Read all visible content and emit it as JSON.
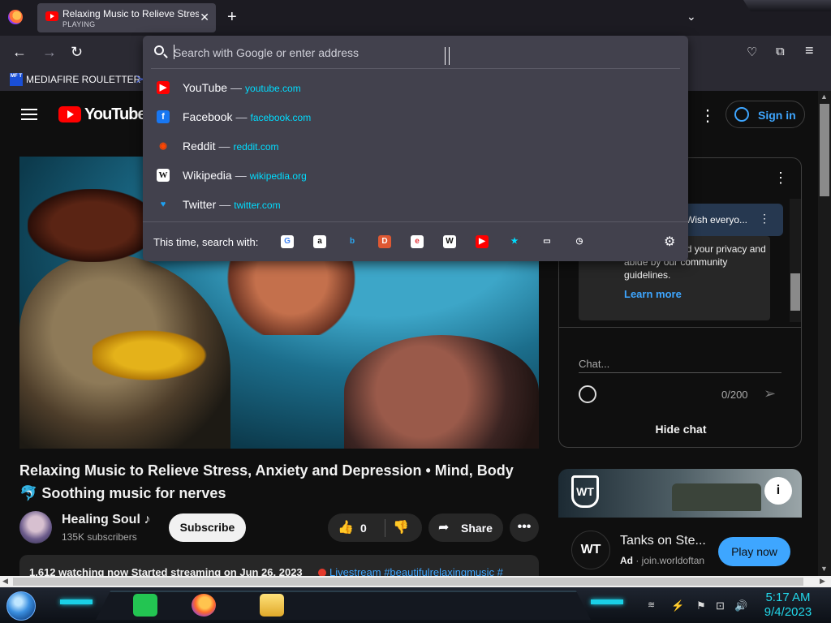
{
  "browser": {
    "tab_title": "Relaxing Music to Relieve Stress, Anxiety and Depression",
    "tab_status": "PLAYING",
    "new_tab_symbol": "+",
    "tab_close_symbol": "✕",
    "list_all_tabs_symbol": "⌄"
  },
  "nav": {
    "back_symbol": "←",
    "forward_symbol": "→",
    "reload_symbol": "↻",
    "pocket_symbol": "♡",
    "extensions_symbol": "⧉",
    "menu_symbol": "≡"
  },
  "bookmarks": {
    "icon_text": "MF T",
    "items": [
      {
        "label": "MEDIAFIRE ROULETTER"
      }
    ],
    "more_symbol": "≻"
  },
  "urlbar": {
    "placeholder": "Search with Google or enter address",
    "value": "",
    "suggestions": [
      {
        "site": "YouTube",
        "url": "youtube.com",
        "icon": "youtube-icon",
        "icon_text": "▶",
        "color": "#ff0000"
      },
      {
        "site": "Facebook",
        "url": "facebook.com",
        "icon": "facebook-icon",
        "icon_text": "f",
        "color": "#1877f2"
      },
      {
        "site": "Reddit",
        "url": "reddit.com",
        "icon": "reddit-icon",
        "icon_text": "◉",
        "color": "#ff4500"
      },
      {
        "site": "Wikipedia",
        "url": "wikipedia.org",
        "icon": "wikipedia-icon",
        "icon_text": "W",
        "color": "#ffffff"
      },
      {
        "site": "Twitter",
        "url": "twitter.com",
        "icon": "twitter-icon",
        "icon_text": "♥",
        "color": "#1da1f2"
      }
    ],
    "separator": "—",
    "search_with_label": "This time, search with:",
    "engines": [
      {
        "name": "google-icon",
        "glyph": "G",
        "color": "#4285f4",
        "bg": "#ffffff"
      },
      {
        "name": "amazon-icon",
        "glyph": "a",
        "color": "#111111",
        "bg": "#ffffff"
      },
      {
        "name": "bing-icon",
        "glyph": "b",
        "color": "#2aa8f2",
        "bg": "#42414d"
      },
      {
        "name": "duckduckgo-icon",
        "glyph": "D",
        "color": "#ffffff",
        "bg": "#de5833"
      },
      {
        "name": "ebay-icon",
        "glyph": "e",
        "color": "#e53238",
        "bg": "#ffffff"
      },
      {
        "name": "wikipedia-icon",
        "glyph": "W",
        "color": "#111111",
        "bg": "#ffffff"
      },
      {
        "name": "youtube-search-icon",
        "glyph": "▶",
        "color": "#ffffff",
        "bg": "#ff0000"
      },
      {
        "name": "bookmarks-icon",
        "glyph": "★",
        "color": "#00ddff",
        "bg": "#42414d"
      },
      {
        "name": "tabs-icon",
        "glyph": "▭",
        "color": "#fbfbfe",
        "bg": "#42414d"
      },
      {
        "name": "history-icon",
        "glyph": "◷",
        "color": "#fbfbfe",
        "bg": "#42414d"
      }
    ],
    "settings_symbol": "⚙"
  },
  "youtube": {
    "logo_text": "YouTube",
    "more_symbol": "⋮",
    "sign_in": "Sign in",
    "video_title": "Relaxing Music to Relieve Stress, Anxiety and Depression • Mind, Body 🐬 Soothing music for nerves",
    "channel": "Healing Soul ♪",
    "subscribers": "135K subscribers",
    "subscribe": "Subscribe",
    "likes": "0",
    "like_symbol": "👍",
    "dislike_symbol": "👎",
    "share": "Share",
    "share_symbol": "➦",
    "more_actions_symbol": "•••",
    "description_line": "1,612 watching now  Started streaming on Jun 26, 2023",
    "description_tags": "Livestream #beautifulrelaxingmusic #"
  },
  "chat": {
    "more_symbol": "⋮",
    "pinned_text": "Wish everyo...",
    "notice_text": "e chat! ... guard your privacy and abide by our community guidelines.",
    "learn_more": "Learn more",
    "input_placeholder": "Chat...",
    "char_count": "0/200",
    "send_symbol": "➢",
    "hide_chat": "Hide chat"
  },
  "ad": {
    "logo_text": "WT",
    "info_symbol": "i",
    "name": "Tanks on Ste...",
    "label": "Ad",
    "domain": "join.worldoftan",
    "cta": "Play now"
  },
  "scrollbars": {
    "up": "▲",
    "down": "▼",
    "left": "◀",
    "right": "▶"
  },
  "taskbar": {
    "time": "5:17 AM",
    "date": "9/4/2023",
    "tray": [
      "⏶",
      "⚑",
      "⊡",
      "🔊"
    ]
  }
}
